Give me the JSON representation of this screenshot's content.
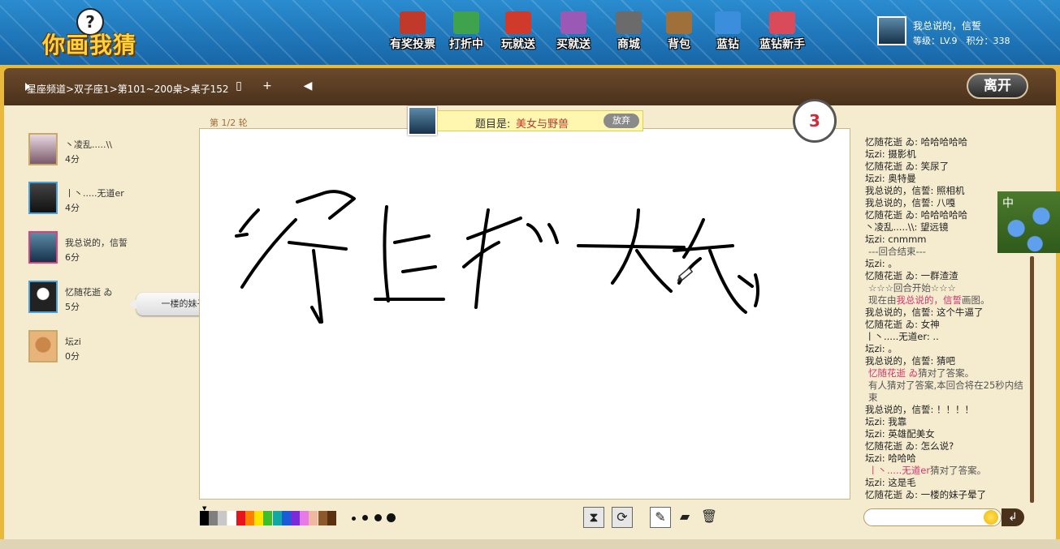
{
  "logo": {
    "text": "你画我猜",
    "question": "?"
  },
  "nav": [
    {
      "label": "有奖投票",
      "color": "#c0392b"
    },
    {
      "label": "打折中",
      "color": "#3fa34d"
    },
    {
      "label": "玩就送",
      "color": "#d03a2a"
    },
    {
      "label": "买就送",
      "color": "#9b59b6"
    },
    {
      "label": "商城",
      "color": "#6b6b6b"
    },
    {
      "label": "背包",
      "color": "#a0703a"
    },
    {
      "label": "蓝钻",
      "color": "#3a8edb"
    },
    {
      "label": "蓝钻新手",
      "color": "#d94a5a"
    }
  ],
  "user": {
    "name": "我总说的，信誓",
    "level": "等级：LV.9　积分：338"
  },
  "toolbar": {
    "breadcrumb": "星座频道>双子座1>第101~200桌>桌子152",
    "leave_label": "离开"
  },
  "players": [
    {
      "name": "丶凌乱.....\\\\",
      "score": "4分"
    },
    {
      "name": "丨丶.....无道er",
      "score": "4分"
    },
    {
      "name": "我总说的，信誓",
      "score": "6分"
    },
    {
      "name": "忆随花逝 ゐ",
      "score": "5分"
    },
    {
      "name": "坛zi",
      "score": "0分"
    }
  ],
  "bubble": "一楼的妹子晕了",
  "round": "第 1/2 轮",
  "topic": {
    "label": "题目是:",
    "value": "美女与野兽",
    "giveup_label": "放弃"
  },
  "timer": "3",
  "palette": [
    "#000000",
    "#7f7f7f",
    "#c8c8c8",
    "#ffffff",
    "#e8141c",
    "#ff7f00",
    "#ffe400",
    "#3cbf2a",
    "#12a7a7",
    "#1c5bd8",
    "#7a2ad8",
    "#e87ae8",
    "#f0b8a0",
    "#8a5a2a",
    "#5a3010"
  ],
  "chat": [
    {
      "text": "忆随花逝 ゐ: 哈哈哈哈哈",
      "kind": "msg"
    },
    {
      "text": "坛zi: 摄影机",
      "kind": "msg"
    },
    {
      "text": "忆随花逝 ゐ: 笑尿了",
      "kind": "msg"
    },
    {
      "text": "坛zi: 奥特曼",
      "kind": "msg"
    },
    {
      "text": "我总说的，信誓: 照相机",
      "kind": "msg"
    },
    {
      "text": "我总说的，信誓: 八嘎",
      "kind": "msg"
    },
    {
      "text": "忆随花逝 ゐ: 哈哈哈哈哈",
      "kind": "msg"
    },
    {
      "text": "丶凌乱.....\\\\: 望远镜",
      "kind": "msg"
    },
    {
      "text": "坛zi: cnmmm",
      "kind": "msg"
    },
    {
      "text": "---回合结束---",
      "kind": "sys"
    },
    {
      "text": "坛zi: 。",
      "kind": "msg"
    },
    {
      "text": "忆随花逝 ゐ: 一群渣渣",
      "kind": "msg"
    },
    {
      "text": "☆☆☆回合开始☆☆☆",
      "kind": "sys"
    },
    {
      "pre": "现在由",
      "name": "我总说的，信誓",
      "post": "画图。",
      "kind": "sysname"
    },
    {
      "text": "我总说的，信誓: 这个牛逼了",
      "kind": "msg"
    },
    {
      "text": "忆随花逝 ゐ: 女神",
      "kind": "msg"
    },
    {
      "text": "丨丶.....无道er: ..",
      "kind": "msg"
    },
    {
      "text": "坛zi: 。",
      "kind": "msg"
    },
    {
      "text": "我总说的，信誓: 猜吧",
      "kind": "msg"
    },
    {
      "pre": "",
      "name": "忆随花逝 ゐ",
      "post": "猜对了答案。",
      "kind": "sysname"
    },
    {
      "text": "有人猜对了答案,本回合将在25秒内结束",
      "kind": "sys"
    },
    {
      "text": "我总说的，信誓: ！！！！",
      "kind": "msg"
    },
    {
      "text": "坛zi: 我靠",
      "kind": "msg"
    },
    {
      "text": "坛zi: 英雄配美女",
      "kind": "msg"
    },
    {
      "text": "忆随花逝 ゐ: 怎么说?",
      "kind": "msg"
    },
    {
      "text": "坛zi: 哈哈哈",
      "kind": "msg"
    },
    {
      "pre": "",
      "name": "丨丶.....无道er",
      "post": "猜对了答案。",
      "kind": "sysname"
    },
    {
      "text": "坛zi: 这是毛",
      "kind": "msg"
    },
    {
      "text": "忆随花逝 ゐ: 一楼的妹子晕了",
      "kind": "msg"
    }
  ],
  "ime": {
    "text": "中"
  }
}
